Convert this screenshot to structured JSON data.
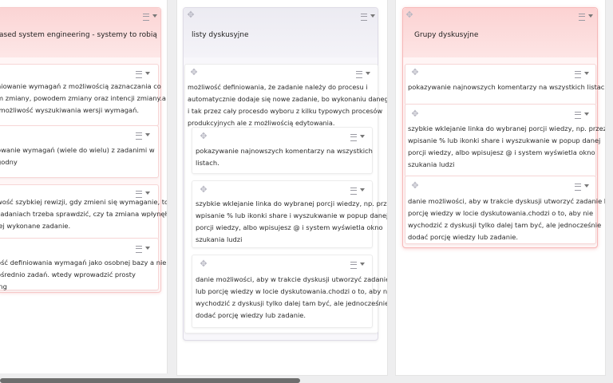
{
  "columns": [
    {
      "title": "ased system engineering - systemy to robią",
      "cards": [
        "niowanie wymagań z możliwością zaznaczania co\nm zmiany, powodem zmiany oraz intencji zmiany.a\n możliwość wyszukiwania wersji wymagań.",
        "owanie wymagań (wiele do wielu) z zadanimi w\ngodny",
        "wość szybkiej rewizji, gdy zmieni się wymaganie, to\nzadaniach trzeba sprawdzić, czy ta zmiana wpłynęła\nłej wykonane zadanie.",
        "ość definiowania wymagań jako osobnej bazy a nie\nośrednio zadań. wtedy wprowadzić prosty\ning"
      ]
    },
    {
      "title": "listy dyskusyjne",
      "parent_card": "możliwość definiowania, że zadanie należy do procesu i\nautomatycznie dodaje się nowe zadanie, bo wykonaniu danego\ni tak przez cały procesdo wyboru z kilku typowych procesów\nprodukcyjnych ale z możliwością edytowania.",
      "cards": [
        "pokazywanie najnowszych komentarzy na wszystkich\nlistach.",
        "szybkie wklejanie linka do wybranej porcji wiedzy, np. przez\nwpisanie % lub ikonki share i wyszukwanie w popup danej\nporcji wiedzy, albo wpisujesz @ i system wyświetla okno\nszukania ludzi",
        "danie możliwości, aby w trakcie dyskusji utworzyć zadanie\nlub porcję wiedzy w locie dyskutowania.chodzi o to, aby nie\nwychodzić z dyskusji tylko dalej tam być, ale jednocześnie\ndodać porcję wiedzy lub zadanie."
      ]
    },
    {
      "title": "Grupy dyskusyjne",
      "cards": [
        "pokazywanie najnowszych komentarzy na wszystkich listach.",
        "szybkie wklejanie linka do wybranej porcji wiedzy, np. przez\nwpisanie % lub ikonki share i wyszukwanie w popup danej\nporcji wiedzy, albo wpisujesz @ i system wyświetla okno\nszukania ludzi",
        "danie możliwości, aby w trakcie dyskusji utworzyć zadanie lub\nporcję wiedzy w locie dyskutowania.chodzi o to, aby nie\nwychodzić z dyskusji tylko dalej tam być, ale jednocześnie\ndodać porcję wiedzy lub zadanie."
      ]
    }
  ],
  "icons": {
    "drag": "drag-move-icon",
    "menu": "hamburger-menu-icon",
    "dropdown": "caret-down-icon"
  },
  "colors": {
    "pink_header": "#fbd4d4",
    "lavender_header": "#ecebf2",
    "card_border": "#ececec"
  }
}
